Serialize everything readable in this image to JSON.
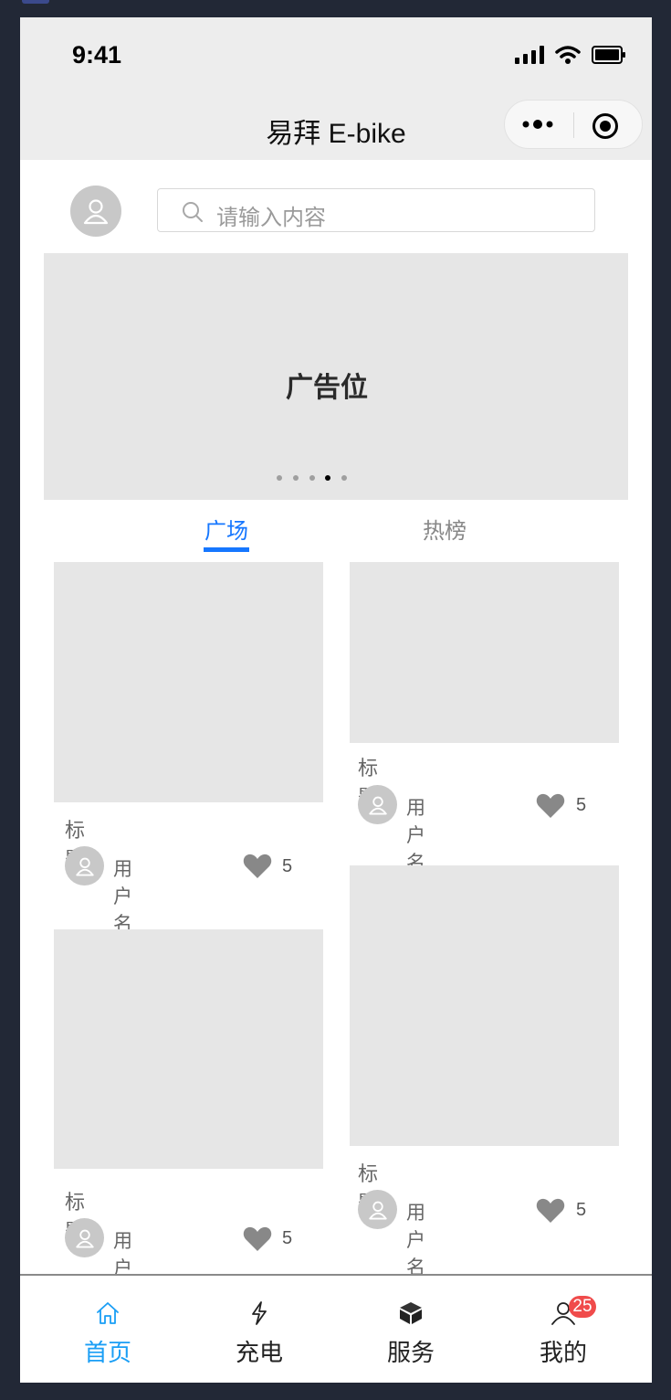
{
  "status_bar": {
    "time": "9:41"
  },
  "nav": {
    "title": "易拜 E-bike"
  },
  "search": {
    "placeholder": "请输入内容"
  },
  "banner": {
    "text": "广告位",
    "dot_count": 5,
    "active_dot": 4
  },
  "tabs": [
    {
      "label": "广场",
      "active": true
    },
    {
      "label": "热榜",
      "active": false
    }
  ],
  "posts": [
    {
      "title": "标题...",
      "username": "用户名",
      "likes": "5"
    },
    {
      "title": "标题...",
      "username": "用户名",
      "likes": "5"
    },
    {
      "title": "标题...",
      "username": "用户名",
      "likes": "5"
    },
    {
      "title": "标题...",
      "username": "用户名",
      "likes": "5"
    }
  ],
  "tabbar": {
    "items": [
      {
        "label": "首页",
        "icon": "home-icon",
        "active": true
      },
      {
        "label": "充电",
        "icon": "bolt-icon",
        "active": false
      },
      {
        "label": "服务",
        "icon": "cube-icon",
        "active": false
      },
      {
        "label": "我的",
        "icon": "user-icon",
        "active": false
      }
    ],
    "badge": "25"
  },
  "colors": {
    "accent": "#1677ff",
    "tabbar_active": "#1a9ef5",
    "badge": "#f04b4b",
    "placeholder": "#e6e6e6"
  }
}
